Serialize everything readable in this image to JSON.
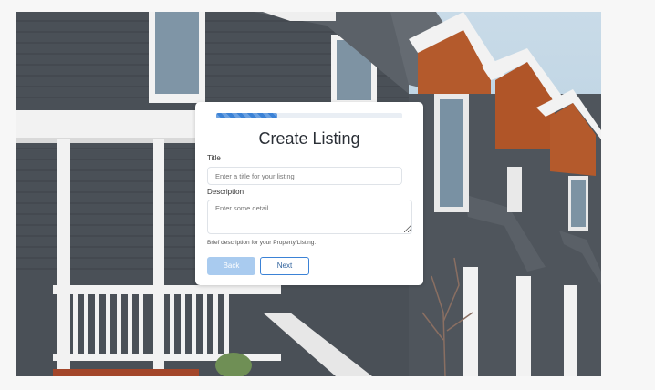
{
  "form": {
    "heading": "Create Listing",
    "progress_fraction": 0.33,
    "progress_color": "#3b82d6",
    "title_label": "Title",
    "title_placeholder": "Enter a title for your listing",
    "title_value": "",
    "description_label": "Description",
    "description_placeholder": "Enter some detail",
    "description_value": "",
    "description_help": "Brief description for your Property/Listing.",
    "back_label": "Back",
    "next_label": "Next"
  },
  "colors": {
    "primary": "#3b82d6",
    "back_disabled": "#a9cbef",
    "siding": "#4a5057",
    "trim": "#f2f2f2",
    "gable_wood": "#b45a2c"
  },
  "background": {
    "image_subject": "row-of-townhouses-photo"
  }
}
